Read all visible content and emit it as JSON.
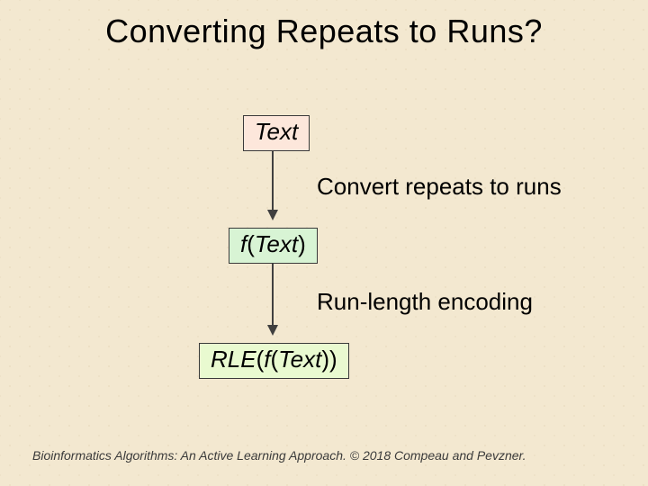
{
  "title": "Converting Repeats to Runs?",
  "nodes": {
    "text": {
      "label": "Text"
    },
    "f": {
      "prefix": "f",
      "open": "(",
      "inner": "Text",
      "close": ")"
    },
    "rle": {
      "prefix": "RLE",
      "open": "(",
      "f": "f",
      "open2": "(",
      "inner": "Text",
      "close2": ")",
      "close": ")"
    }
  },
  "steps": {
    "convert": "Convert repeats to runs",
    "rle": "Run-length encoding"
  },
  "footer": "Bioinformatics Algorithms: An Active Learning Approach. © 2018 Compeau and Pevzner."
}
